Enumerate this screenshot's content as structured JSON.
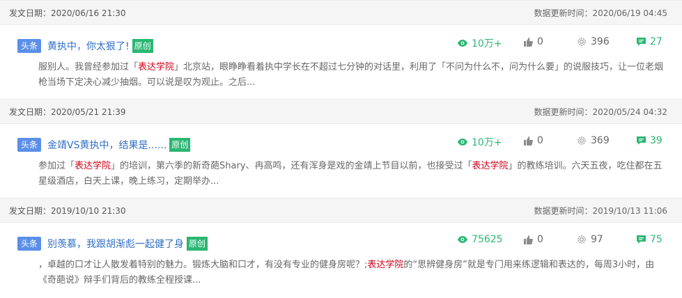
{
  "colors": {
    "accent_green": "#2bb673",
    "tag_blue": "#5b8fe8",
    "title_blue": "#2f6ec4",
    "highlight_red": "#d0021b"
  },
  "posts": [
    {
      "date_label": "发文日期：2020/06/16 21:30",
      "update_label": "数据更新时间：2020/06/19 04:45",
      "tag": "头条",
      "title": "黄执中，你太狠了!",
      "original": "原创",
      "views": "10万+",
      "likes": "0",
      "shares": "396",
      "comments": "27",
      "desc": [
        "服别人。我曾经参加过「",
        "表达学院",
        "」北京站，眼睁睁看着执中学长在不超过七分钟的对话里，利用了「不问为什么不，问为什么要」的说服技巧，让一位老烟枪当场下定决心减少抽烟。可以说是叹为观止。之后..."
      ]
    },
    {
      "date_label": "发文日期：2020/05/21 21:39",
      "update_label": "数据更新时间：2020/05/24 04:32",
      "tag": "头条",
      "title": "金靖VS黄执中，结果是......",
      "original": "原创",
      "views": "10万+",
      "likes": "0",
      "shares": "369",
      "comments": "39",
      "desc": [
        "参加过「",
        "表达学院",
        "」的培训，第六季的新奇葩Shary、冉高鸣，还有浑身是戏的金靖上节目以前，也接受过「",
        "表达学院",
        "」的教练培训。六天五夜，吃住都在五星级酒店，白天上课，晚上练习，定期举办..."
      ]
    },
    {
      "date_label": "发文日期：2019/10/10 21:30",
      "update_label": "数据更新时间：2019/10/13 11:06",
      "tag": "头条",
      "title": "别羡慕，我跟胡渐彪一起健了身",
      "original": "原创",
      "views": "75625",
      "likes": "0",
      "shares": "97",
      "comments": "75",
      "desc": [
        "，卓越的口才让人散发着特别的魅力。锻炼大脑和口才，有没有专业的健身房呢？;",
        "表达学院",
        "的“思辨健身房”就是专门用来练逻辑和表达的，每周3小时，由《奇葩说》辩手们背后的教练全程授课..."
      ]
    }
  ]
}
